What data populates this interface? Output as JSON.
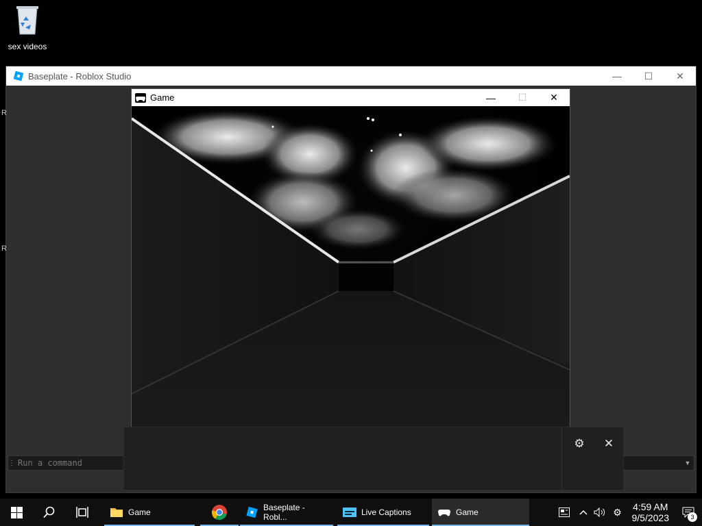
{
  "desktop": {
    "icons": [
      {
        "label": "sex videos",
        "icon": "recycle-bin-icon"
      }
    ]
  },
  "studio": {
    "title": "Baseplate - Roblox Studio",
    "side_letters": [
      "R",
      "R"
    ],
    "command_bar": {
      "placeholder": "Run a command",
      "value": "Run a command"
    }
  },
  "game_window": {
    "title": "Game",
    "icon": "gamepad-icon"
  },
  "live_captions": {
    "settings_icon": "gear-icon",
    "close_icon": "close-icon"
  },
  "taskbar": {
    "apps": [
      {
        "label": "Game",
        "icon": "folder-icon"
      },
      {
        "label": "",
        "icon": "chrome-icon"
      },
      {
        "label": "Baseplate - Robl...",
        "icon": "roblox-studio-icon"
      },
      {
        "label": "Live Captions",
        "icon": "live-captions-icon"
      },
      {
        "label": "Game",
        "icon": "gamepad-icon"
      }
    ],
    "clock": {
      "time": "4:59 AM",
      "date": "9/5/2023"
    },
    "notification_count": "3"
  },
  "colors": {
    "taskbar_bg": "#101010",
    "studio_bg": "#2e2e2e",
    "running_indicator": "#76b9ed",
    "captions_bg": "#202020"
  }
}
